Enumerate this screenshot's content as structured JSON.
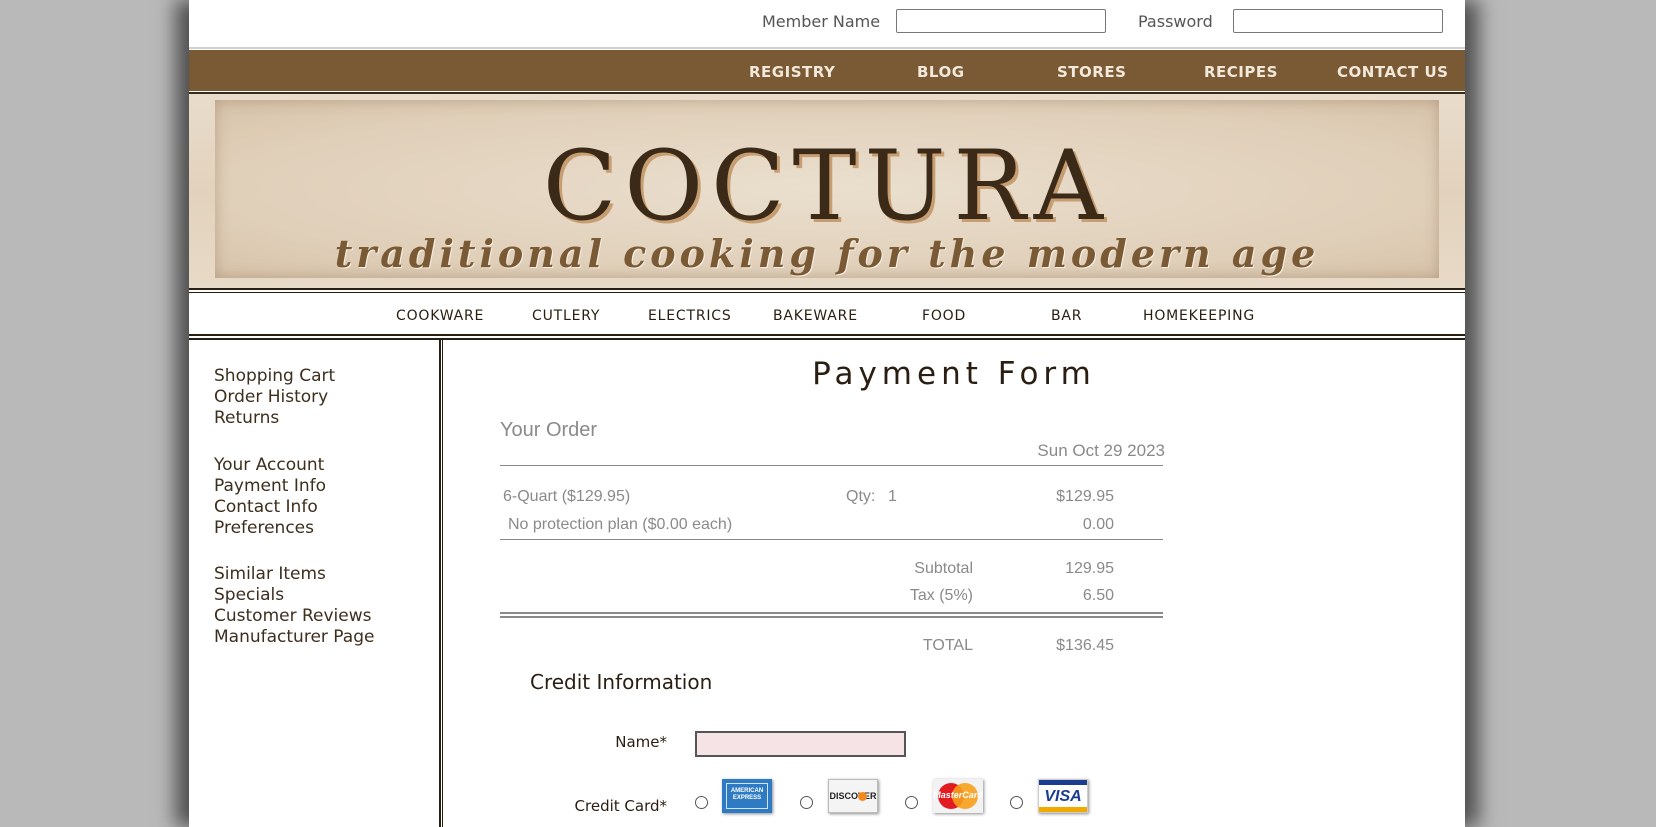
{
  "login": {
    "member_label": "Member Name",
    "member_value": "",
    "password_label": "Password",
    "password_value": ""
  },
  "topnav": [
    "REGISTRY",
    "BLOG",
    "STORES",
    "RECIPES",
    "CONTACT US"
  ],
  "banner": {
    "logo": "COCTURA",
    "tagline": "traditional cooking for the modern age"
  },
  "catnav": [
    "COOKWARE",
    "CUTLERY",
    "ELECTRICS",
    "BAKEWARE",
    "FOOD",
    "BAR",
    "HOMEKEEPING"
  ],
  "sidebar": {
    "group1": [
      "Shopping Cart",
      "Order History",
      "Returns"
    ],
    "group2": [
      "Your Account",
      "Payment Info",
      "Contact Info",
      "Preferences"
    ],
    "group3": [
      "Similar Items",
      "Specials",
      "Customer Reviews",
      "Manufacturer Page"
    ]
  },
  "form": {
    "title": "Payment Form",
    "your_order": "Your Order",
    "date": "Sun Oct 29 2023",
    "item_name": "6-Quart ($129.95)",
    "qty_label": "Qty:",
    "qty_value": "1",
    "item_price": "$129.95",
    "protection": "No protection plan ($0.00 each)",
    "protection_price": "0.00",
    "subtotal_label": "Subtotal",
    "subtotal_value": "129.95",
    "tax_label": "Tax (5%)",
    "tax_value": "6.50",
    "total_label": "TOTAL",
    "total_value": "$136.45",
    "credit_title": "Credit Information",
    "name_label": "Name*",
    "name_value": "",
    "cc_label": "Credit Card*",
    "cards": {
      "amex": "AMERICAN EXPRESS",
      "discover": "DISCOVER",
      "mastercard": "MasterCard",
      "visa": "VISA"
    }
  },
  "colors": {
    "nav_brown": "#7a5a35",
    "dark_brown": "#2a1e12",
    "muted_gray": "#8a8a8a",
    "name_field_bg": "#f6e3e6"
  }
}
